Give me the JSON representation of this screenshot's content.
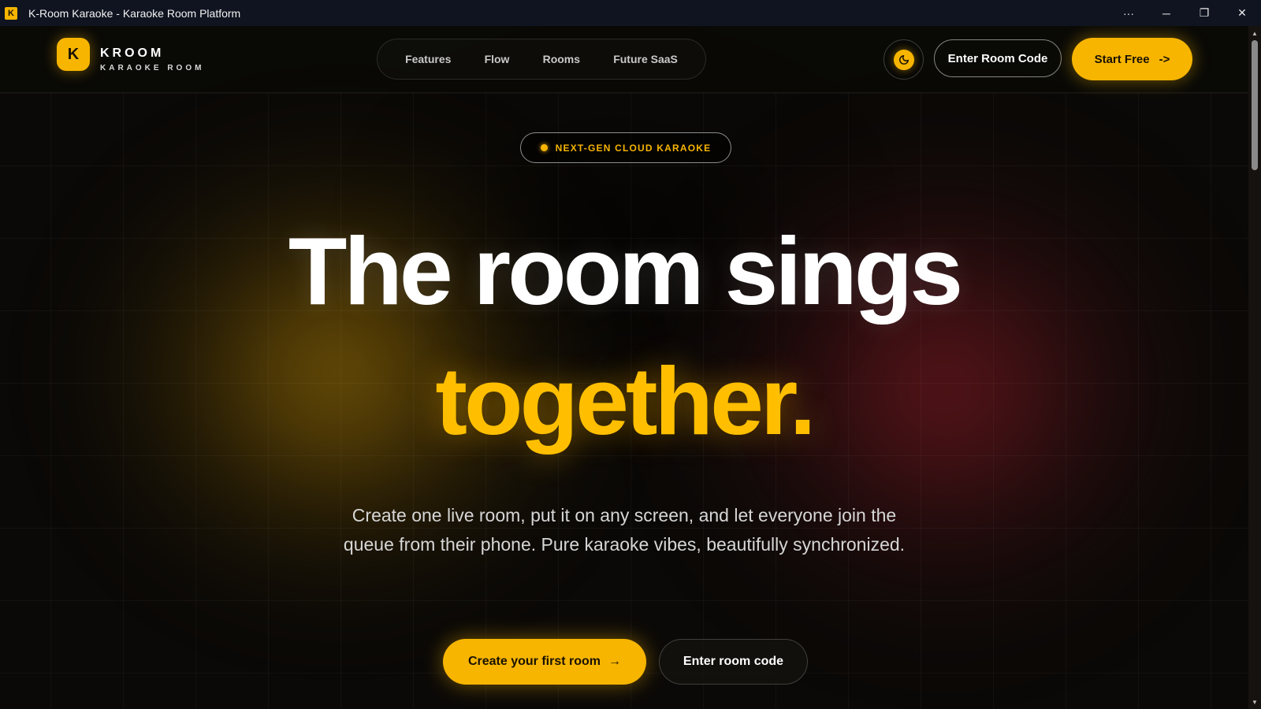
{
  "window": {
    "app_icon_letter": "K",
    "title": "K-Room Karaoke - Karaoke Room Platform",
    "controls": {
      "more": "···",
      "minimize": "─",
      "restore": "❐",
      "close": "✕"
    }
  },
  "header": {
    "logo_letter": "K",
    "brand_name": "KROOM",
    "brand_sub": "KARAOKE ROOM",
    "nav": [
      {
        "label": "Features"
      },
      {
        "label": "Flow"
      },
      {
        "label": "Rooms"
      },
      {
        "label": "Future SaaS"
      }
    ],
    "theme_toggle_icon": "moon-icon",
    "enter_code_label": "Enter Room Code",
    "start_free_label": "Start Free",
    "start_free_arrow": "->"
  },
  "hero": {
    "badge": "NEXT-GEN CLOUD KARAOKE",
    "headline_line1": "The room sings",
    "headline_line2": "together.",
    "subtext": "Create one live room, put it on any screen, and let everyone join the queue from their phone. Pure karaoke vibes, beautifully synchronized.",
    "cta_primary": "Create your first room",
    "cta_primary_arrow": "→",
    "cta_secondary": "Enter room code"
  },
  "scrollbar": {
    "up": "▲",
    "down": "▼"
  },
  "colors": {
    "accent": "#f7b500",
    "headline_accent": "#ffbf00",
    "background": "#0b0907",
    "titlebar": "#0f1420"
  }
}
